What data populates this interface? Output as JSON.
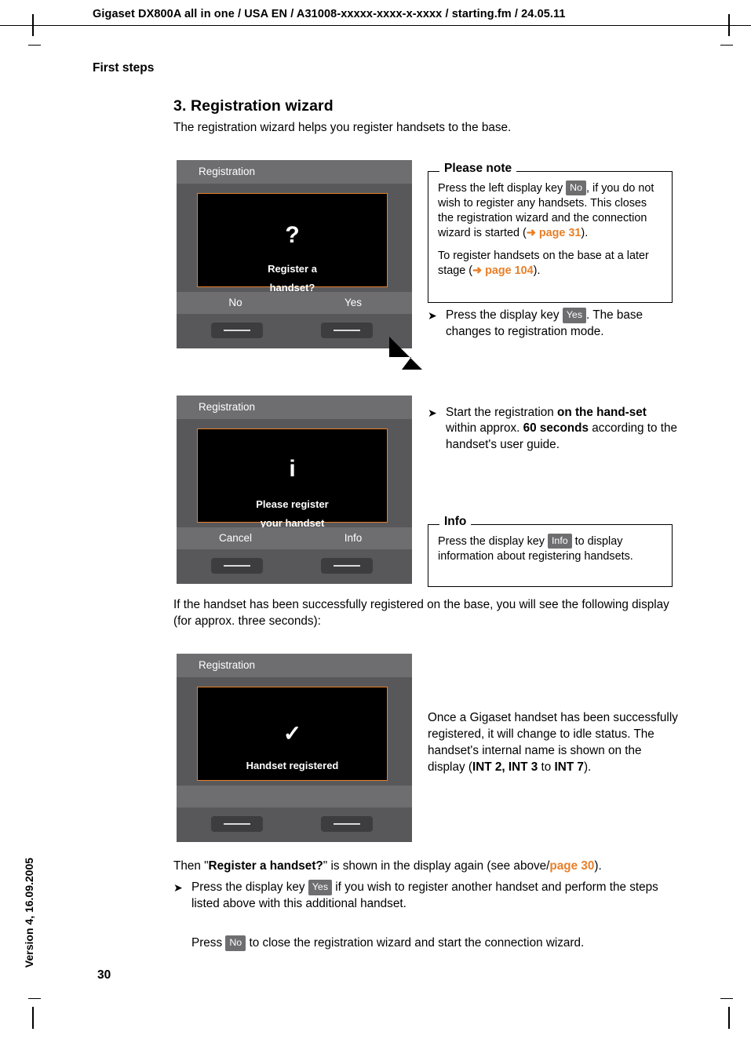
{
  "header": {
    "line": "Gigaset DX800A all in one / USA EN / A31008-xxxxx-xxxx-x-xxxx / starting.fm / 24.05.11",
    "running_head": "First steps",
    "side_version": "Version 4, 16.09.2005",
    "page_number": "30"
  },
  "section": {
    "title": "3. Registration wizard",
    "intro": "The registration wizard helps you register handsets to the base."
  },
  "phone1": {
    "title": "Registration",
    "glyph": "?",
    "line1": "Register a",
    "line2": "handset?",
    "softkey_left": "No",
    "softkey_right": "Yes"
  },
  "phone2": {
    "title": "Registration",
    "glyph": "i",
    "line1": "Please register",
    "line2": "your handset",
    "softkey_left": "Cancel",
    "softkey_right": "Info"
  },
  "phone3": {
    "title": "Registration",
    "glyph": "✓",
    "line1": "Handset registered",
    "line2": "",
    "softkey_left": "",
    "softkey_right": ""
  },
  "note1": {
    "title": "Please note",
    "p1_a": "Press the left display key ",
    "p1_key": "No",
    "p1_b": ", if you do not wish to register any handsets. This closes the registration wizard and the connection wizard is started (",
    "p1_arrow": "➜",
    "p1_link": "page 31",
    "p1_c": ").",
    "p2_a": "To register handsets on the base at a later stage (",
    "p2_arrow": "➜",
    "p2_link": "page 104",
    "p2_b": ")."
  },
  "note2": {
    "title": "Info",
    "p1_a": "Press the display key ",
    "p1_key": "Info",
    "p1_b": " to display information about registering handsets."
  },
  "bullet1": {
    "marker": "➤",
    "a": "Press the display key ",
    "key": "Yes",
    "b": ". The base changes to registration mode."
  },
  "bullet2": {
    "marker": "➤",
    "a": "Start the registration ",
    "b_bold": "on the hand-set",
    "c": " within approx. ",
    "d_bold": "60 seconds",
    "e": " according to the handset's user guide."
  },
  "para1": {
    "text": "If the handset has been successfully registered on the base, you will see the following display (for approx. three seconds):"
  },
  "para2": {
    "a": "Once a Gigaset handset has been successfully registered, it will change to idle status. The handset's internal name is shown on the display (",
    "b_bold": "INT 2, INT 3",
    "c": " to ",
    "d_bold": "INT 7",
    "e": ")."
  },
  "para3": {
    "a": "Then \"",
    "b_bold": "Register a handset?",
    "c": "\" is shown in the display again (see above/",
    "link": "page 30",
    "d": ")."
  },
  "bullet3": {
    "marker": "➤",
    "a": "Press the display key ",
    "key": "Yes",
    "b": " if you wish to register another handset and perform the steps listed above with this additional handset."
  },
  "para4": {
    "a": "Press ",
    "key": "No",
    "b": " to close the registration wizard and start the connection wizard."
  },
  "colors": {
    "accent": "#e8802a",
    "phone_body": "#58585a",
    "phone_bar": "#6e6e70"
  }
}
